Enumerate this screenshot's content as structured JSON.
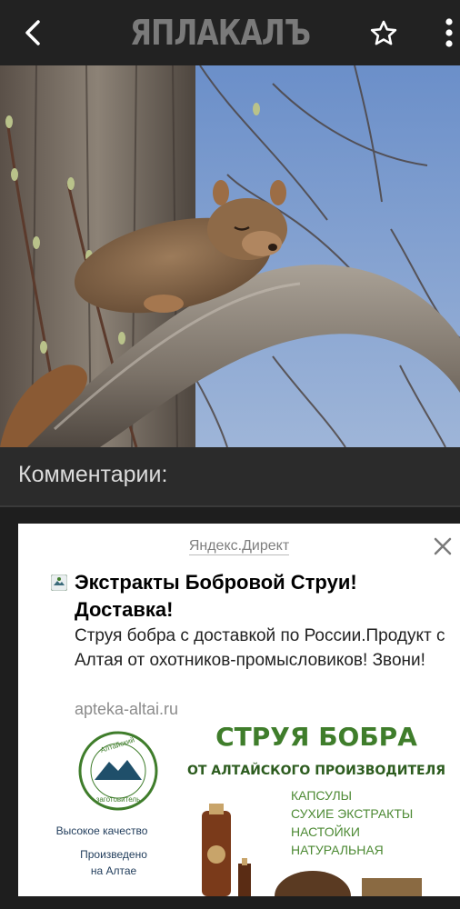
{
  "header": {
    "logo_text": "ЯПЛАКАЛЪ",
    "back_icon": "chevron-left-icon",
    "favorite_icon": "star-outline-icon",
    "menu_icon": "more-vertical-icon"
  },
  "photo": {
    "subject": "squirrel-sleeping-on-branch"
  },
  "comments": {
    "title": "Комментарии:"
  },
  "ad": {
    "source": "Яндекс.Директ",
    "title": "Экстракты Бобровой Струи! Доставка!",
    "description": "Струя бобра с доставкой по России.Продукт с Алтая от охотников-промысловиков! Звони!",
    "domain": "apteka-altai.ru",
    "banner": {
      "headline": "СТРУЯ БОБРА",
      "subheadline": "ОТ АЛТАЙСКОГО ПРОИЗВОДИТЕЛЯ",
      "features": [
        "КАПСУЛЫ",
        "СУХИЕ ЭКСТРАКТЫ",
        "НАСТОЙКИ",
        "НАТУРАЛЬНАЯ"
      ],
      "badges": [
        "Высокое качество",
        "Произведено",
        "на Алтае"
      ],
      "logo_text_top": "Алтайский",
      "logo_text_bottom": "заготовитель"
    }
  },
  "colors": {
    "topbar": "#222222",
    "background": "#1e1e1e",
    "banner_green": "#3f7d2b",
    "banner_dark_green": "#2d5c1f"
  }
}
